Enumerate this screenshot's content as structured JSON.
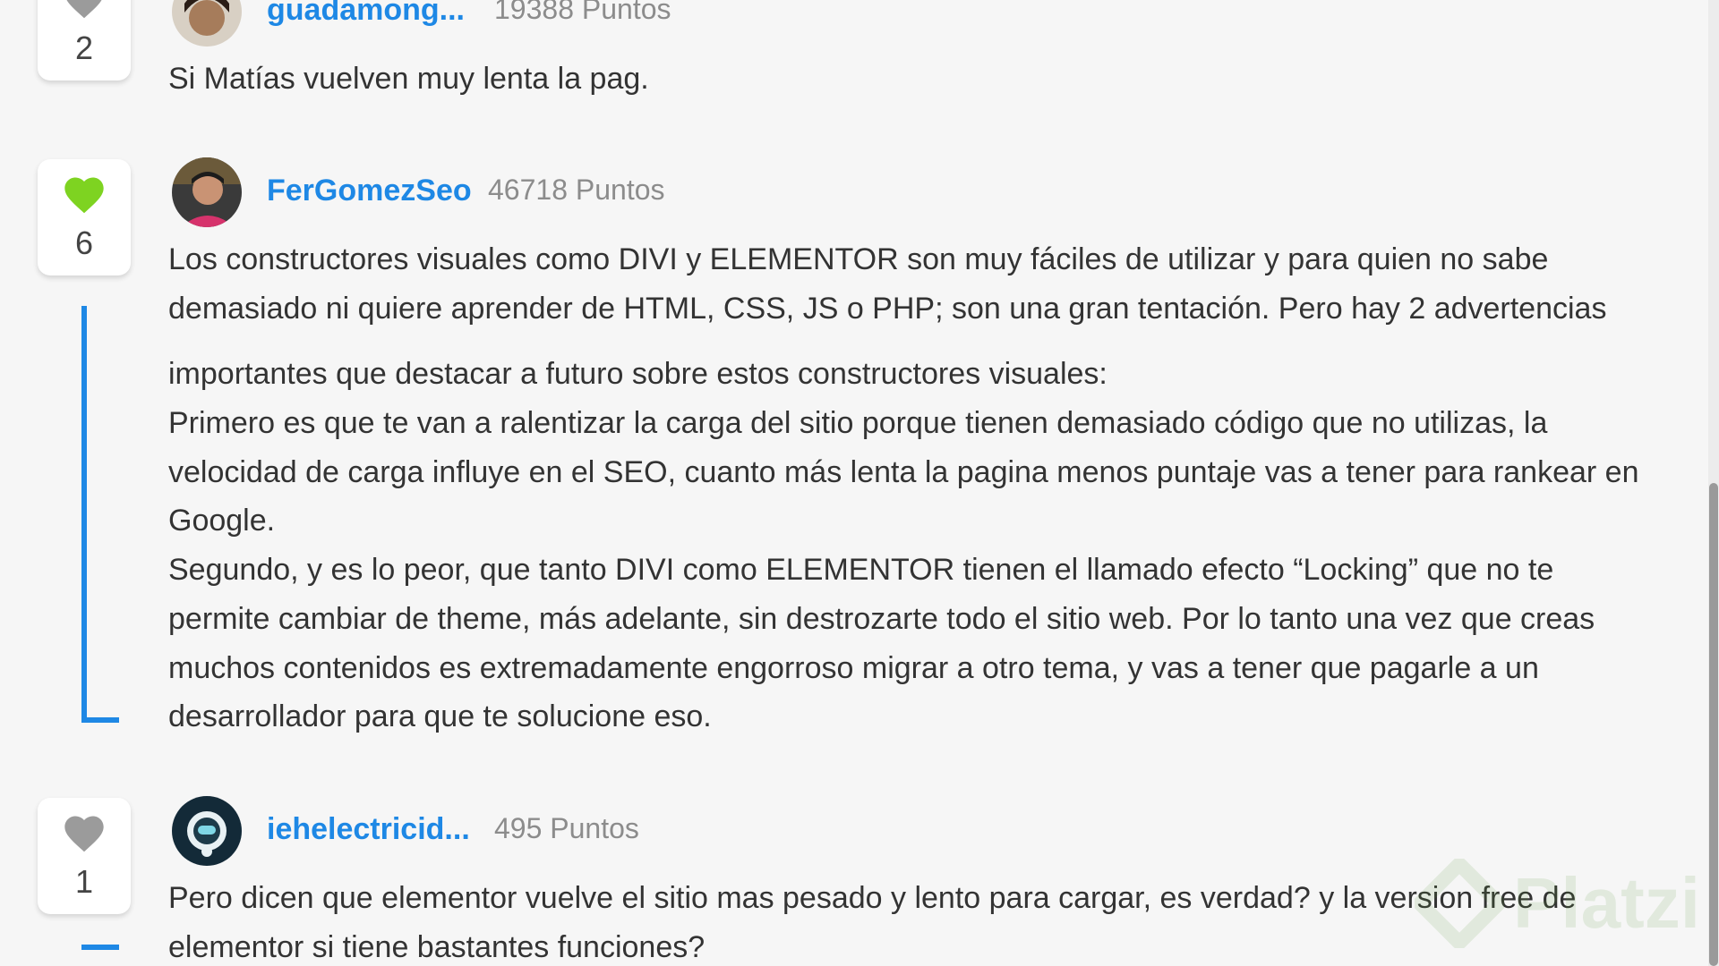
{
  "comments": [
    {
      "username": "guadamong...",
      "points": "19388 Puntos",
      "votes": "2",
      "liked": false,
      "lines": [
        "Si Matías vuelven muy lenta la pag."
      ]
    },
    {
      "username": "FerGomezSeo",
      "points": "46718 Puntos",
      "votes": "6",
      "liked": true,
      "lines": [
        "Los constructores visuales como DIVI y ELEMENTOR son muy fáciles de utilizar y para quien no sabe",
        "demasiado ni quiere aprender de HTML, CSS, JS o PHP; son una gran tentación. Pero hay 2 advertencias",
        "importantes que destacar a futuro sobre estos constructores visuales:",
        "Primero es que te van a ralentizar la carga del sitio porque tienen demasiado código que no utilizas, la",
        "velocidad de carga influye en el SEO, cuanto más lenta la pagina menos puntaje vas a tener para rankear en",
        "Google.",
        "Segundo, y es lo peor, que tanto DIVI como ELEMENTOR tienen el llamado efecto “Locking” que no te",
        "permite cambiar de theme, más adelante, sin destrozarte todo el sitio web. Por lo tanto una vez que creas",
        "muchos contenidos es extremadamente engorroso migrar a otro tema, y vas a tener que pagarle a un",
        "desarrollador para que te solucione eso."
      ]
    },
    {
      "username": "iehelectricid...",
      "points": "495 Puntos",
      "votes": "1",
      "liked": false,
      "lines": [
        "Pero dicen que elementor vuelve el sitio mas pesado y lento para cargar, es verdad? y la version free de",
        "elementor si tiene bastantes funciones?"
      ]
    }
  ],
  "watermark": "Platzi",
  "colors": {
    "accent": "#1e88e5",
    "liked_heart": "#7ed321",
    "heart": "#9b9b9b",
    "text": "#333333",
    "muted": "#8c8c8c",
    "background": "#f6f6f6"
  }
}
